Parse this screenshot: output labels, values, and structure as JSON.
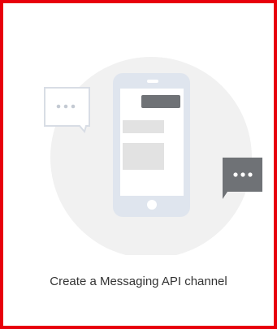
{
  "card": {
    "label": "Create a Messaging API channel"
  },
  "illustration": {
    "icons": [
      "phone-icon",
      "chat-bubble-outline-icon",
      "chat-bubble-filled-icon"
    ]
  },
  "colors": {
    "border": "#e8000b",
    "circle": "#f1f1f1",
    "phone": "#dfe5ee",
    "dark_bubble": "#6f7276",
    "text": "#333333"
  }
}
